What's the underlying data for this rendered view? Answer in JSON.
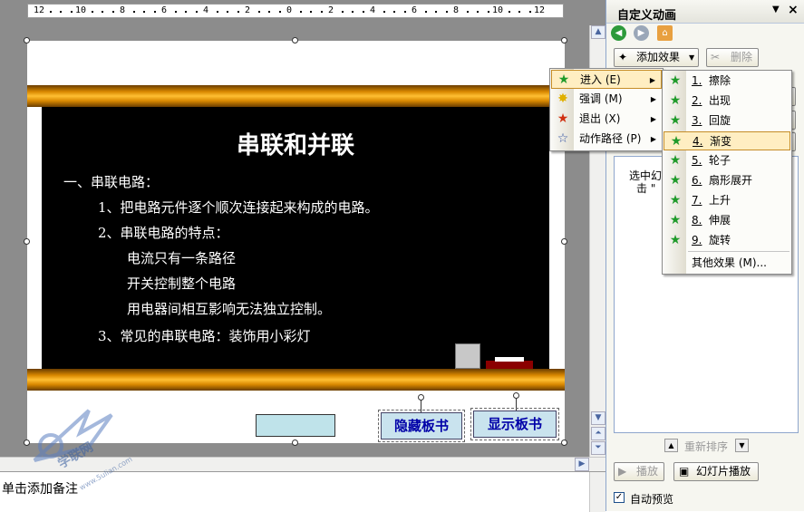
{
  "ruler": {
    "ticks": [
      "12",
      "10",
      "8",
      "6",
      "4",
      "2",
      "0",
      "2",
      "4",
      "6",
      "8",
      "10",
      "12"
    ]
  },
  "slide": {
    "title": "串联和并联",
    "lines": [
      "一、串联电路：",
      "1、把电路元件逐个顺次连接起来构成的电路。",
      "2、串联电路的特点：",
      "电流只有一条路径",
      "开关控制整个电路",
      "用电器间相互影响无法独立控制。",
      "3、常见的串联电路：装饰用小彩灯"
    ],
    "button_hide": "隐藏板书",
    "button_show": "显示板书"
  },
  "notes": {
    "placeholder": "单击添加备注"
  },
  "watermark": {
    "text": "学联网",
    "url": "www.5ulian.com"
  },
  "pane": {
    "title": "自定义动画",
    "add_effect": "添加效果",
    "delete": "删除",
    "list_hint_1": "选中幻",
    "list_hint_2": "击 \"",
    "reorder": "重新排序",
    "play": "播放",
    "slideshow": "幻灯片播放",
    "autopreview": "自动预览",
    "autopreview_checked": true
  },
  "effect_menu": {
    "items": [
      {
        "label": "进入 (E)",
        "icon": "green-star-icon"
      },
      {
        "label": "强调 (M)",
        "icon": "yellow-star-icon"
      },
      {
        "label": "退出 (X)",
        "icon": "red-star-icon"
      },
      {
        "label": "动作路径 (P)",
        "icon": "outline-star-icon"
      }
    ],
    "highlighted": 0
  },
  "entrance_menu": {
    "items": [
      {
        "num": "1.",
        "label": "擦除"
      },
      {
        "num": "2.",
        "label": "出现"
      },
      {
        "num": "3.",
        "label": "回旋"
      },
      {
        "num": "4.",
        "label": "渐变"
      },
      {
        "num": "5.",
        "label": "轮子"
      },
      {
        "num": "6.",
        "label": "扇形展开"
      },
      {
        "num": "7.",
        "label": "上升"
      },
      {
        "num": "8.",
        "label": "伸展"
      },
      {
        "num": "9.",
        "label": "旋转"
      }
    ],
    "more": "其他效果 (M)...",
    "highlighted": 3
  },
  "colors": {
    "menu_highlight": "#ffeec2",
    "slide_button_text": "#0000a8",
    "board": "#000000",
    "bar_orange": "#ffbf33"
  }
}
